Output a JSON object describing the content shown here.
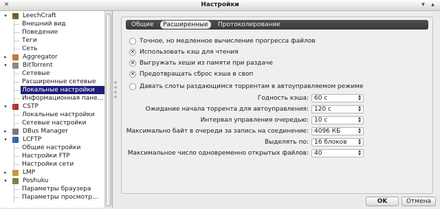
{
  "window": {
    "title": "Настройки"
  },
  "sidebar": {
    "items": [
      {
        "label": "LeechCraft",
        "level": 0,
        "toggle": "-",
        "icon": "app-icon",
        "color": "#7a5a2a"
      },
      {
        "label": "Внешний вид",
        "level": 1
      },
      {
        "label": "Поведение",
        "level": 1
      },
      {
        "label": "Теги",
        "level": 1
      },
      {
        "label": "Сеть",
        "level": 1
      },
      {
        "label": "Aggregator",
        "level": 0,
        "toggle": "+",
        "icon": "feed-icon",
        "color": "#c0782a"
      },
      {
        "label": "BitTorrent",
        "level": 0,
        "toggle": "-",
        "icon": "torrent-icon",
        "color": "#888888"
      },
      {
        "label": "Сетевые",
        "level": 1
      },
      {
        "label": "Расширенные сетевые",
        "level": 1
      },
      {
        "label": "Локальные настройки",
        "level": 1,
        "selected": true
      },
      {
        "label": "Информационная пане...",
        "level": 1
      },
      {
        "label": "CSTP",
        "level": 0,
        "toggle": "-",
        "icon": "download-icon",
        "color": "#b03030"
      },
      {
        "label": "Локальные настройки",
        "level": 1
      },
      {
        "label": "Сетевые настройки",
        "level": 1
      },
      {
        "label": "DBus Manager",
        "level": 0,
        "toggle": "+",
        "icon": "bus-icon",
        "color": "#777777"
      },
      {
        "label": "LCFTP",
        "level": 0,
        "toggle": "-",
        "icon": "ftp-icon",
        "color": "#3060b0"
      },
      {
        "label": "Общие настройки",
        "level": 1
      },
      {
        "label": "Настройки FTP",
        "level": 1
      },
      {
        "label": "Настройки сети",
        "level": 1
      },
      {
        "label": "LMP",
        "level": 0,
        "toggle": "+",
        "icon": "media-icon",
        "color": "#c89a3a"
      },
      {
        "label": "Poshuku",
        "level": 0,
        "toggle": "-",
        "icon": "browser-icon",
        "color": "#6a8a3a"
      },
      {
        "label": "Параметры браузера",
        "level": 1
      },
      {
        "label": "Параметры просмотр...",
        "level": 1
      }
    ]
  },
  "tabs": [
    {
      "label": "Общие",
      "active": false
    },
    {
      "label": "Расширенные",
      "active": true
    },
    {
      "label": "Протоколирование",
      "active": false
    }
  ],
  "checkboxes": [
    {
      "label": "Точное, но медленное вычисление прогресса файлов",
      "checked": false
    },
    {
      "label": "Использовать кэш для чтения",
      "checked": true
    },
    {
      "label": "Выгружать хеши из памяти при раздаче",
      "checked": true
    },
    {
      "label": "Предотвращать сброс кэша в своп",
      "checked": true
    },
    {
      "label": "Давать слоты раздающимся торрентам в автоуправляемом режиме",
      "checked": false
    }
  ],
  "fields": [
    {
      "label": "Годность кэша:",
      "value": "60 с"
    },
    {
      "label": "Ожидание начала торрента для автоуправления:",
      "value": "120 с"
    },
    {
      "label": "Интервал управления очередью:",
      "value": "10 с"
    },
    {
      "label": "Максимально байт в очереди за запись на соединение:",
      "value": "4096 КБ"
    },
    {
      "label": "Выделять по:",
      "value": "16 блоков"
    },
    {
      "label": "Максимальное число одновременно открытых файлов:",
      "value": "40"
    }
  ],
  "buttons": {
    "ok": "OK",
    "cancel": "Отмена"
  }
}
